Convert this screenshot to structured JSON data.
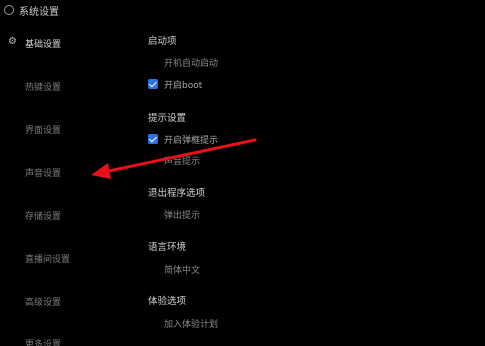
{
  "window": {
    "title": "系统设置"
  },
  "sidebar": {
    "items": [
      {
        "label": "基础设置"
      },
      {
        "label": "热键设置"
      },
      {
        "label": "界面设置"
      },
      {
        "label": "声音设置"
      },
      {
        "label": "存储设置"
      },
      {
        "label": "直播间设置"
      },
      {
        "label": "高级设置"
      },
      {
        "label": "更多设置"
      }
    ]
  },
  "content": {
    "sections": [
      {
        "title": "启动项",
        "options": [
          {
            "label": "开机自动启动",
            "type": "radio",
            "checked": false
          },
          {
            "label": "开启boot",
            "type": "checkbox",
            "checked": true
          }
        ]
      },
      {
        "title": "提示设置",
        "options": [
          {
            "label": "开启弹框提示",
            "type": "checkbox",
            "checked": true
          },
          {
            "label": "声音提示",
            "type": "radio",
            "checked": false
          }
        ]
      },
      {
        "title": "退出程序选项",
        "options": [
          {
            "label": "弹出提示",
            "type": "radio",
            "checked": false
          }
        ]
      },
      {
        "title": "语言环境",
        "options": [
          {
            "label": "简体中文",
            "type": "radio",
            "checked": false
          }
        ]
      },
      {
        "title": "体验选项",
        "options": [
          {
            "label": "加入体验计划",
            "type": "radio",
            "checked": false
          }
        ]
      }
    ]
  },
  "annotation": {
    "arrow_color": "#e8101a"
  }
}
